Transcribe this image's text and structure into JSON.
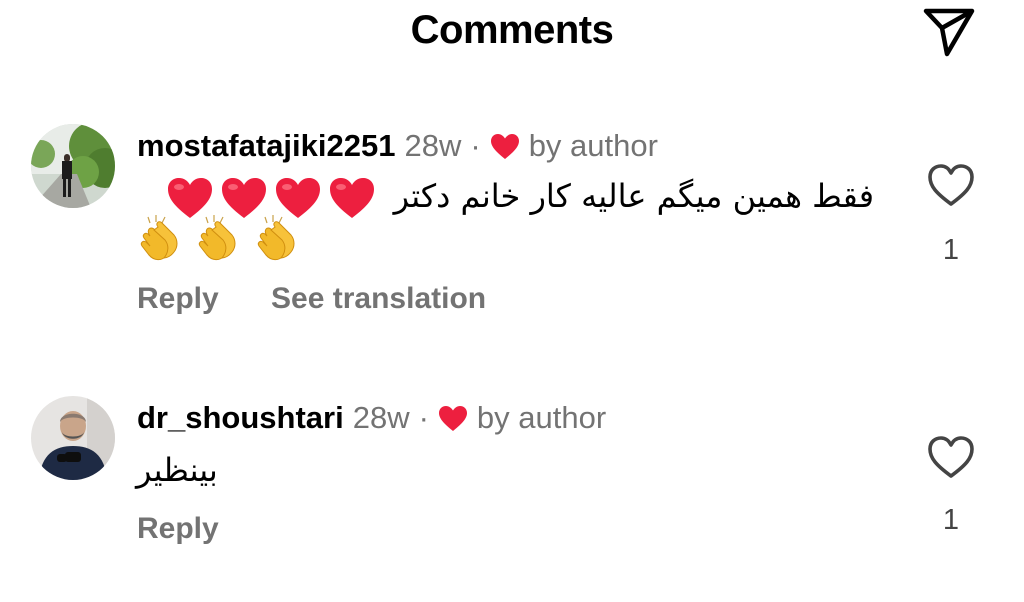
{
  "header": {
    "title": "Comments",
    "send_icon": "paper-plane-icon"
  },
  "comments": [
    {
      "username": "mostafatajiki2251",
      "age": "28w",
      "separator": "·",
      "liked_by_author_icon": "heart-icon",
      "by_author": "by author",
      "text": "فقط همین میگم عالیه کار خانم دکتر",
      "emojis": [
        "red-heart",
        "red-heart",
        "red-heart",
        "red-heart",
        "clapping-hands",
        "clapping-hands",
        "clapping-hands"
      ],
      "actions": {
        "reply": "Reply",
        "translate": "See translation"
      },
      "like_icon": "heart-outline-icon",
      "like_count": "1"
    },
    {
      "username": "dr_shoushtari",
      "age": "28w",
      "separator": "·",
      "liked_by_author_icon": "heart-icon",
      "by_author": "by author",
      "text": "بینظیر",
      "actions": {
        "reply": "Reply"
      },
      "like_icon": "heart-outline-icon",
      "like_count": "1"
    }
  ],
  "colors": {
    "heart": "#ed1f3f",
    "secondary_text": "#737373",
    "clap": "#f7c23a"
  }
}
